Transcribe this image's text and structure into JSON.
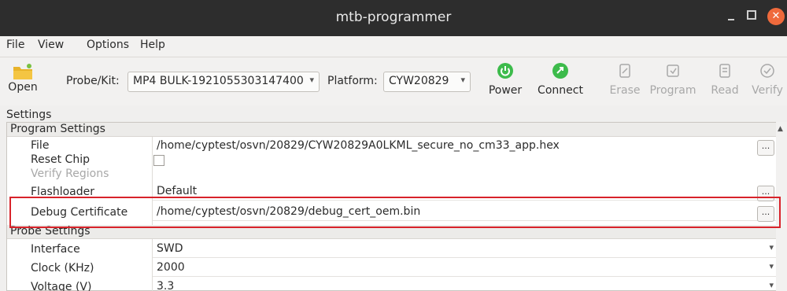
{
  "window": {
    "title": "mtb-programmer"
  },
  "menu": [
    "File",
    "View",
    "Options",
    "Help"
  ],
  "toolbar": {
    "open_label": "Open",
    "probe_label": "Probe/Kit:",
    "probe_value": "MP4 BULK-1921055303147400",
    "platform_label": "Platform:",
    "platform_value": "CYW20829",
    "power_label": "Power",
    "connect_label": "Connect",
    "erase_label": "Erase",
    "program_label": "Program",
    "read_label": "Read",
    "verify_label": "Verify"
  },
  "settings": {
    "caption": "Settings",
    "program_section": "Program Settings",
    "file_label": "File",
    "file_value": "/home/cyptest/osvn/20829/CYW20829A0LKML_secure_no_cm33_app.hex",
    "reset_chip_label": "Reset Chip",
    "reset_chip_checked": false,
    "verify_regions_label": "Verify Regions",
    "flashloader_label": "Flashloader",
    "flashloader_value": "Default",
    "debug_cert_label": "Debug Certificate",
    "debug_cert_value": "/home/cyptest/osvn/20829/debug_cert_oem.bin",
    "probe_section": "Probe Settings",
    "interface_label": "Interface",
    "interface_value": "SWD",
    "clock_label": "Clock (KHz)",
    "clock_value": "2000",
    "voltage_label": "Voltage (V)",
    "voltage_value": "3.3",
    "browse_label": "..."
  },
  "colors": {
    "titlebar": "#2d2d2d",
    "close": "#ef6a3c",
    "power_green": "#3dbb4b",
    "highlight": "#d8232a"
  }
}
